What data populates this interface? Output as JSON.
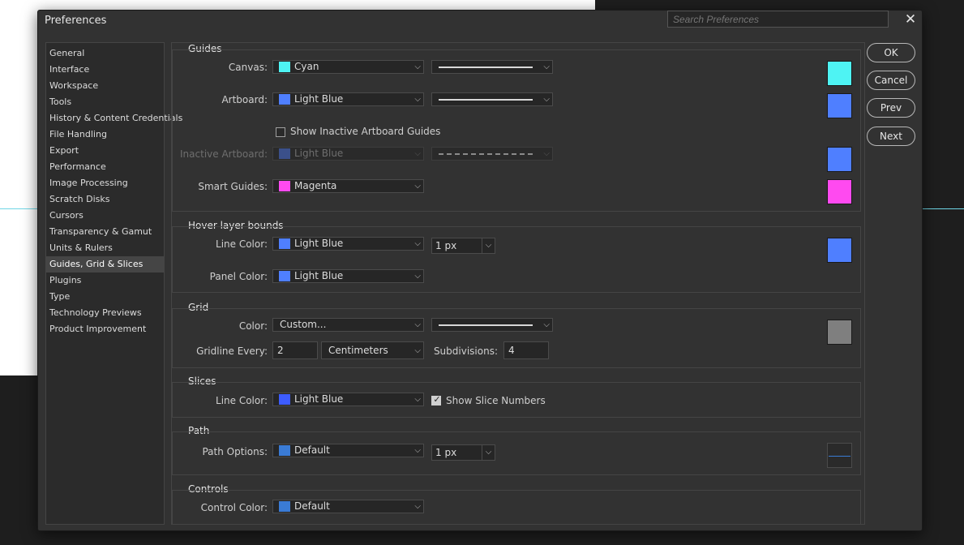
{
  "window": {
    "title": "Preferences",
    "search_placeholder": "Search Preferences",
    "close_glyph": "✕"
  },
  "sidebar": {
    "items": [
      {
        "label": "General"
      },
      {
        "label": "Interface"
      },
      {
        "label": "Workspace"
      },
      {
        "label": "Tools"
      },
      {
        "label": "History & Content Credentials"
      },
      {
        "label": "File Handling"
      },
      {
        "label": "Export"
      },
      {
        "label": "Performance"
      },
      {
        "label": "Image Processing"
      },
      {
        "label": "Scratch Disks"
      },
      {
        "label": "Cursors"
      },
      {
        "label": "Transparency & Gamut"
      },
      {
        "label": "Units & Rulers"
      },
      {
        "label": "Guides, Grid & Slices"
      },
      {
        "label": "Plugins"
      },
      {
        "label": "Type"
      },
      {
        "label": "Technology Previews"
      },
      {
        "label": "Product Improvement"
      }
    ],
    "selected": "Guides, Grid & Slices"
  },
  "guides": {
    "title": "Guides",
    "canvas": {
      "label": "Canvas:",
      "color_name": "Cyan",
      "swatch": "#4ef3f3"
    },
    "artboard": {
      "label": "Artboard:",
      "color_name": "Light Blue",
      "swatch": "#4f7fff"
    },
    "show_inactive": {
      "label": "Show Inactive Artboard Guides",
      "checked": false
    },
    "inactive_artboard": {
      "label": "Inactive Artboard:",
      "color_name": "Light Blue",
      "swatch": "#4f7fff",
      "disabled": true
    },
    "smart_guides": {
      "label": "Smart Guides:",
      "color_name": "Magenta",
      "swatch": "#ff4af0"
    }
  },
  "hover": {
    "title": "Hover layer bounds",
    "line_color": {
      "label": "Line Color:",
      "color_name": "Light Blue",
      "swatch": "#4f7fff"
    },
    "line_width": "1 px",
    "panel_color": {
      "label": "Panel Color:",
      "color_name": "Light Blue",
      "swatch": "#4f7fff"
    }
  },
  "grid": {
    "title": "Grid",
    "color": {
      "label": "Color:",
      "value": "Custom...",
      "swatch": "#7f7f7f"
    },
    "gridline": {
      "label": "Gridline Every:",
      "value": "2",
      "unit": "Centimeters"
    },
    "subdivisions": {
      "label": "Subdivisions:",
      "value": "4"
    }
  },
  "slices": {
    "title": "Slices",
    "line_color": {
      "label": "Line Color:",
      "color_name": "Light Blue",
      "swatch": "#3d5cff"
    },
    "show_numbers": {
      "label": "Show Slice Numbers",
      "checked": true
    }
  },
  "path": {
    "title": "Path",
    "options": {
      "label": "Path Options:",
      "color_name": "Default",
      "swatch": "#3a7bd5"
    },
    "width": "1 px"
  },
  "controls": {
    "title": "Controls",
    "color": {
      "label": "Control Color:",
      "color_name": "Default",
      "swatch": "#3a7bd5"
    }
  },
  "buttons": {
    "ok": "OK",
    "cancel": "Cancel",
    "prev": "Prev",
    "next": "Next"
  }
}
